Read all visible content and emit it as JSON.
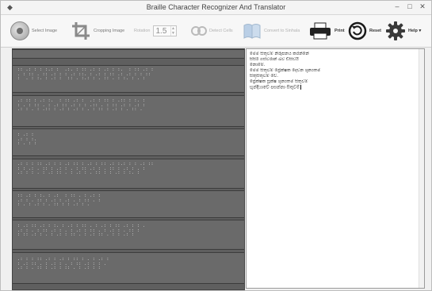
{
  "window": {
    "title": "Braille Character Recognizer And Translator",
    "controls": [
      "–",
      "□",
      "✕"
    ]
  },
  "toolbar": {
    "select_image": "Select Image",
    "cropping_image": "Cropping Image",
    "rotation_label": "Rotation",
    "rotation_value": "1.5",
    "detect_cells": "Detect Cells",
    "convert_to_sinhala": "Convert to Sinhala",
    "print": "Print",
    "reset": "Reset",
    "help": "Help ▾"
  },
  "output_text": {
    "lines": [
      "මෙම සිතුවම් නිරූපනය කරන්නේ",
      "සිසිර් ගස්වරාන් බව ඩිසිඩයි",
      "නොමේ.",
      "මෙම සිතුවම් ප්‍රේක්ෂක දෙවන ශුන්‍යතම",
      "සිතුසිතුවම් වේ.",
      "ප්‍රේක්ෂක සූක්ෂ ශුන්‍යතම සිතුවම්",
      "භූන්දියාවේ පසන්නා සිතුවම්"
    ]
  },
  "colors": {
    "image_background": "#5f5f5f",
    "braille_dots": "#e8e8e8",
    "reset_icon": "#1a1a1a",
    "convert_icon": "#8ab0d9"
  }
}
